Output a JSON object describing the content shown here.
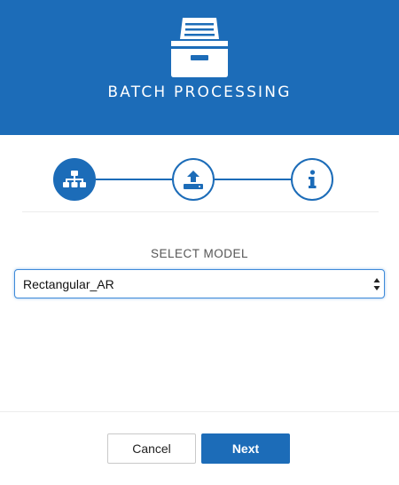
{
  "header": {
    "title": "BATCH PROCESSING",
    "icon": "archive-box-icon",
    "background_color": "#1c6cb8"
  },
  "steps": [
    {
      "icon": "hierarchy-icon",
      "state": "active"
    },
    {
      "icon": "upload-icon",
      "state": "inactive"
    },
    {
      "icon": "info-icon",
      "state": "inactive"
    }
  ],
  "model_select": {
    "label": "SELECT MODEL",
    "selected": "Rectangular_AR"
  },
  "footer": {
    "cancel_label": "Cancel",
    "next_label": "Next"
  },
  "colors": {
    "accent": "#1c6cb8",
    "focus_ring": "#3e8ad9"
  }
}
